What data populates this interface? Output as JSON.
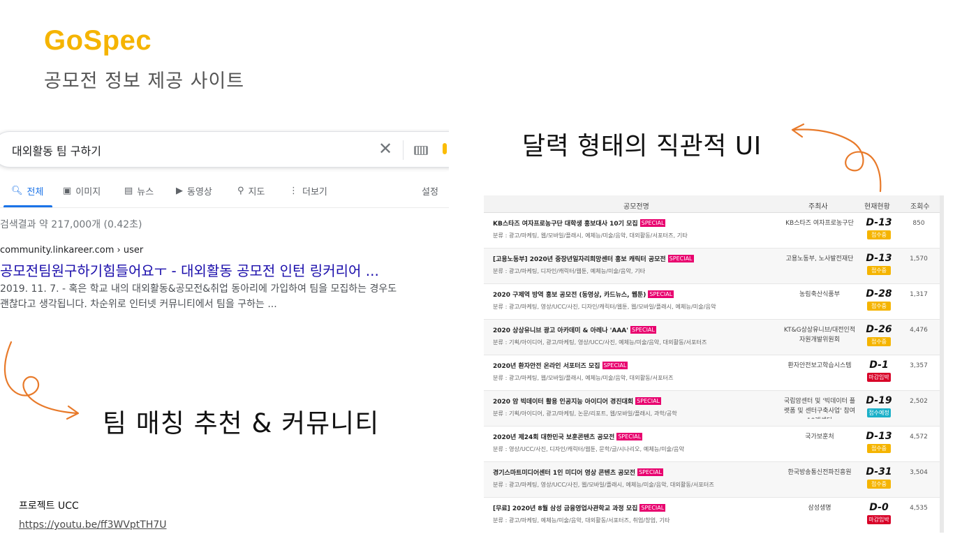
{
  "header": {
    "brand": "GoSpec",
    "subtitle": "공모전 정보 제공 사이트"
  },
  "search": {
    "query": "대외활동 팀 구하기",
    "tabs": [
      {
        "icon": "search-icon",
        "label": "전체"
      },
      {
        "icon": "image-icon",
        "label": "이미지"
      },
      {
        "icon": "news-icon",
        "label": "뉴스"
      },
      {
        "icon": "video-icon",
        "label": "동영상"
      },
      {
        "icon": "map-pin-icon",
        "label": "지도"
      },
      {
        "icon": "more-icon",
        "label": "더보기"
      }
    ],
    "settings": "설정",
    "stats": "검색결과 약 217,000개 (0.42초)",
    "result": {
      "url": "community.linkareer.com › user",
      "title": "공모전팀원구하기힘들어요ㅜ - 대외활동 공모전 인턴 링커리어 ...",
      "snippet_line1": "2019. 11. 7. - 혹은 학교 내의 대외활동&공모전&취업 동아리에 가입하여 팀을 모집하는 경우도",
      "snippet_line2": "괜찮다고 생각됩니다. 차순위로 인터넷 커뮤니티에서 팀을 구하는 ..."
    }
  },
  "annotations": {
    "team": "팀 매칭 추천 & 커뮤니티",
    "calendar": "달력 형태의 직관적 UI",
    "ucc_label": "프로젝트 UCC",
    "ucc_link": "https://youtu.be/ff3WVptTH7U"
  },
  "table": {
    "headers": {
      "title": "공모전명",
      "host": "주최사",
      "status": "현재현황",
      "views": "조회수"
    },
    "special_label": "SPECIAL",
    "rows": [
      {
        "title": "KB스타즈 여자프로농구단 대학생 홍보대사 10기 모집",
        "category": "분류 : 광고/마케팅, 웹/모바일/플래시, 예체능/미술/음악, 대외활동/서포터즈, 기타",
        "host": "KB스타즈 여자프로농구단",
        "dday": "D-13",
        "badge": "접수중",
        "badge_color": "#f5b400",
        "views": "850"
      },
      {
        "title": "[고용노동부] 2020년 중장년일자리희망센터 홍보 캐릭터 공모전",
        "category": "분류 : 광고/마케팅, 디자인/캐릭터/웹툰, 예체능/미술/음악, 기타",
        "host": "고용노동부, 노사발전재단",
        "dday": "D-13",
        "badge": "접수중",
        "badge_color": "#f5b400",
        "views": "1,570"
      },
      {
        "title": "2020 구제역 방역 홍보 공모전 (동영상, 카드뉴스, 웹툰)",
        "category": "분류 : 광고/마케팅, 영상/UCC/사진, 디자인/캐릭터/웹툰, 웹/모바일/플래시, 예체능/미술/음악",
        "host": "농림축산식품부",
        "dday": "D-28",
        "badge": "접수중",
        "badge_color": "#f5b400",
        "views": "1,317"
      },
      {
        "title": "2020 상상유니브 광고 아카데미 & 아레나 'AAA'",
        "category": "분류 : 기획/아이디어, 광고/마케팅, 영상/UCC/사진, 예체능/미술/음악, 대외활동/서포터즈",
        "host": "KT&G상상유니브/대전인적자원개발위원회",
        "dday": "D-26",
        "badge": "접수중",
        "badge_color": "#f5b400",
        "views": "4,476"
      },
      {
        "title": "2020년 환자안전 온라인 서포터즈 모집",
        "category": "분류 : 광고/마케팅, 웹/모바일/플래시, 예체능/미술/음악, 대외활동/서포터즈",
        "host": "환자안전보고학습시스템",
        "dday": "D-1",
        "badge": "마감임박",
        "badge_color": "#d80027",
        "views": "3,357"
      },
      {
        "title": "2020 암 빅데이터 활용 인공지능 아이디어 경진대회",
        "category": "분류 : 기획/아이디어, 광고/마케팅, 논문/리포트, 웹/모바일/플래시, 과학/공학",
        "host": "국립암센터 및 '빅데이터 플랫폼 및 센터구축사업' 참여 10개센터",
        "dday": "D-19",
        "badge": "접수예정",
        "badge_color": "#1bb0c8",
        "views": "2,502"
      },
      {
        "title": "2020년 제24회 대한민국 보훈콘텐츠 공모전",
        "category": "분류 : 영상/UCC/사진, 디자인/캐릭터/웹툰, 문학/글/시나리오, 예체능/미술/음악",
        "host": "국가보훈처",
        "dday": "D-13",
        "badge": "접수중",
        "badge_color": "#f5b400",
        "views": "4,572"
      },
      {
        "title": "경기스마트미디어센터 1인 미디어 영상 콘텐츠 공모전",
        "category": "분류 : 광고/마케팅, 영상/UCC/사진, 웹/모바일/플래시, 예체능/미술/음악, 대외활동/서포터즈",
        "host": "한국방송통신전파진흥원",
        "dday": "D-31",
        "badge": "접수중",
        "badge_color": "#f5b400",
        "views": "3,504"
      },
      {
        "title": "[무료] 2020년 8월 삼성 금융영업사관학교 과정 모집",
        "category": "분류 : 광고/마케팅, 예체능/미술/음악, 대외활동/서포터즈, 취업/창업, 기타",
        "host": "삼성생명",
        "dday": "D-0",
        "badge": "마감임박",
        "badge_color": "#d80027",
        "views": "4,535"
      }
    ]
  },
  "colors": {
    "brand": "#f5b400",
    "arrow": "#e87a2a",
    "link_blue": "#1a0dab",
    "special": "#e8006e"
  }
}
